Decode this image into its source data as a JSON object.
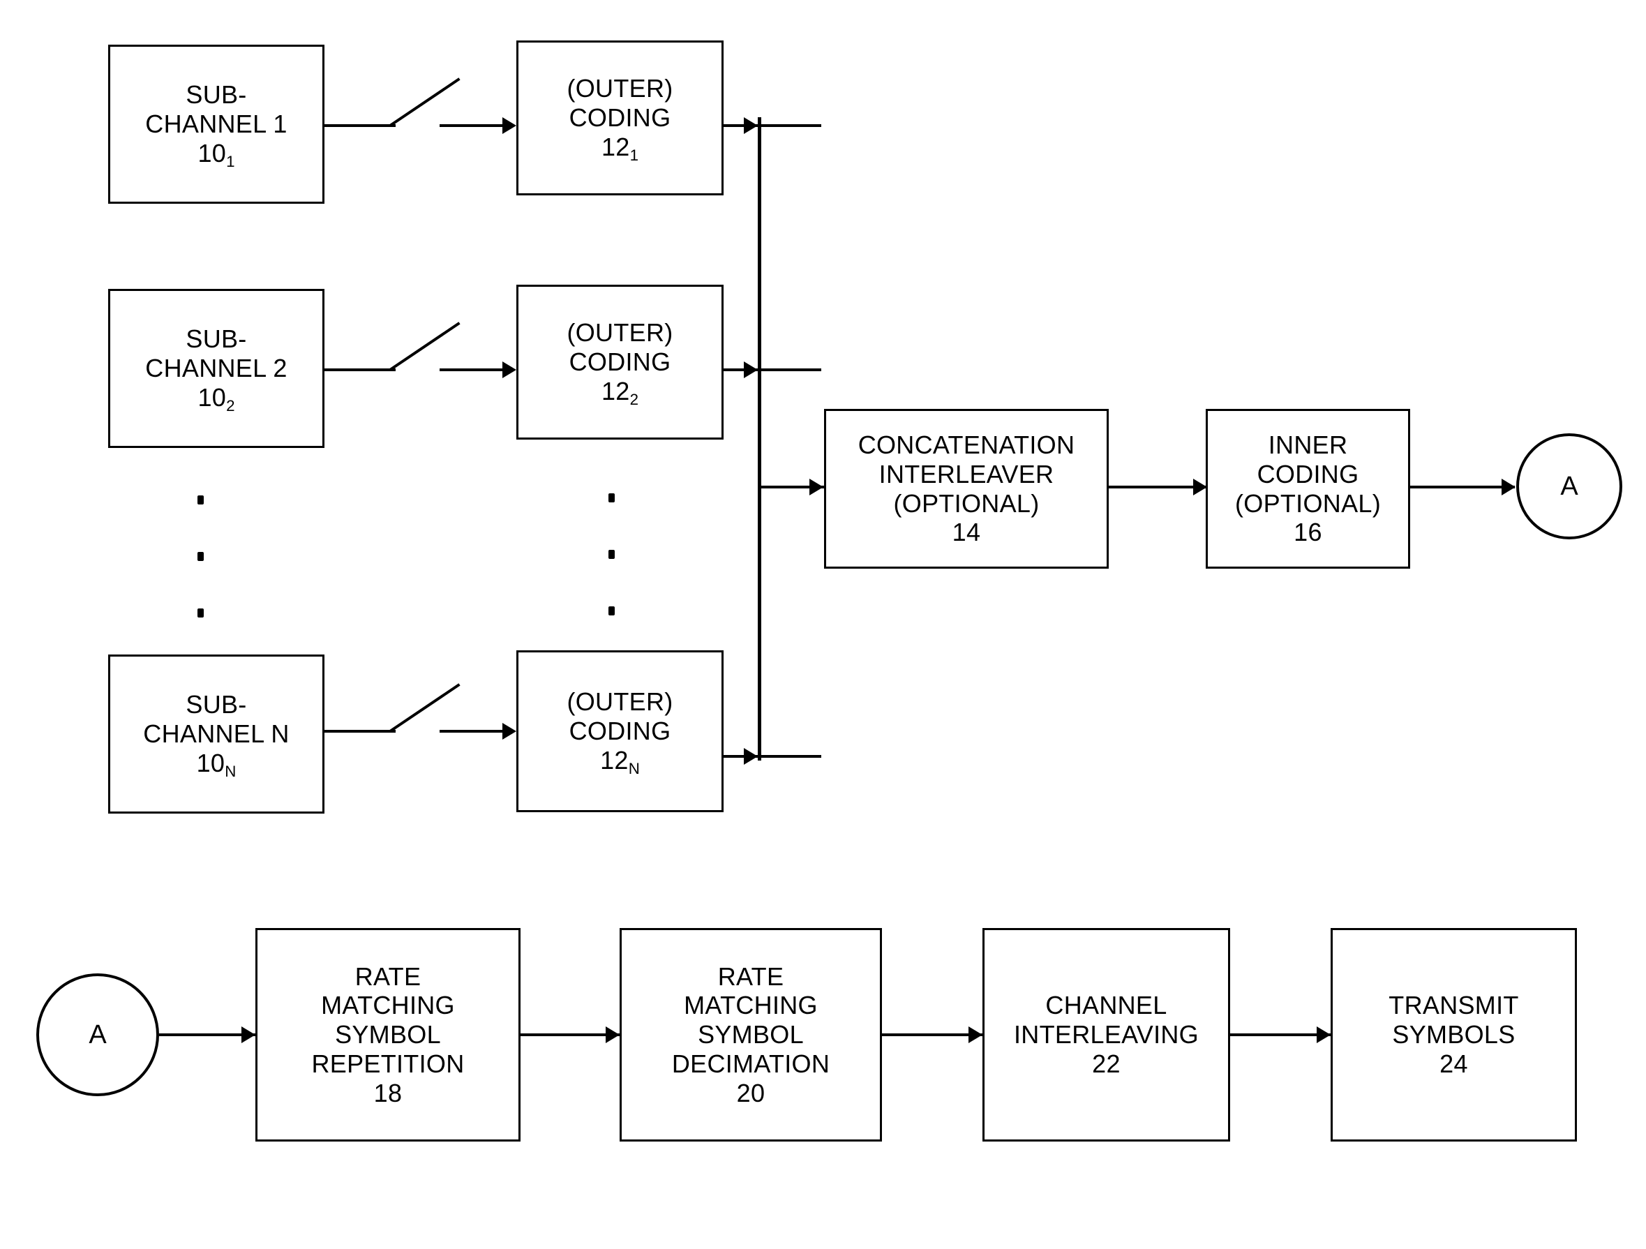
{
  "figure": {
    "type": "block-diagram",
    "title": "",
    "background_color": "#ffffff",
    "line_color": "#000000"
  },
  "row1": {
    "subchannels": [
      {
        "line1": "SUB-",
        "line2": "CHANNEL 1",
        "ref": "10",
        "sub": "1"
      },
      {
        "line1": "SUB-",
        "line2": "CHANNEL 2",
        "ref": "10",
        "sub": "2"
      },
      {
        "line1": "SUB-",
        "line2": "CHANNEL N",
        "ref": "10",
        "sub": "N"
      }
    ],
    "outer_coding": [
      {
        "line1": "(OUTER)",
        "line2": "CODING",
        "ref": "12",
        "sub": "1"
      },
      {
        "line1": "(OUTER)",
        "line2": "CODING",
        "ref": "12",
        "sub": "2"
      },
      {
        "line1": "(OUTER)",
        "line2": "CODING",
        "ref": "12",
        "sub": "N"
      }
    ],
    "concatenation_interleaver": {
      "line1": "CONCATENATION",
      "line2": "INTERLEAVER",
      "line3": "(OPTIONAL)",
      "ref": "14"
    },
    "inner_coding": {
      "line1": "INNER",
      "line2": "CODING",
      "line3": "(OPTIONAL)",
      "ref": "16"
    },
    "connector_out": {
      "label": "A"
    },
    "ellipsis_count": 3
  },
  "row2": {
    "connector_in": {
      "label": "A"
    },
    "rate_matching_repetition": {
      "line1": "RATE",
      "line2": "MATCHING",
      "line3": "SYMBOL",
      "line4": "REPETITION",
      "ref": "18"
    },
    "rate_matching_decimation": {
      "line1": "RATE",
      "line2": "MATCHING",
      "line3": "SYMBOL",
      "line4": "DECIMATION",
      "ref": "20"
    },
    "channel_interleaving": {
      "line1": "CHANNEL",
      "line2": "INTERLEAVING",
      "ref": "22"
    },
    "transmit_symbols": {
      "line1": "TRANSMIT",
      "line2": "SYMBOLS",
      "ref": "24"
    }
  }
}
